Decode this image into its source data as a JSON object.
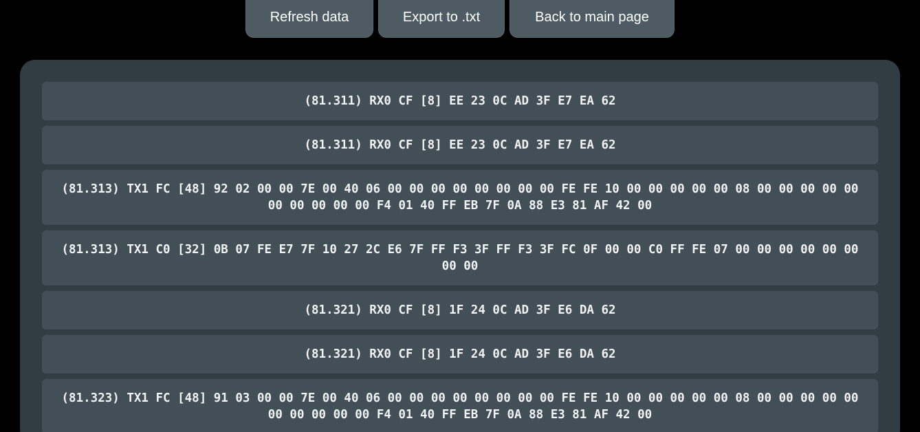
{
  "toolbar": {
    "refresh_label": "Refresh data",
    "export_label": "Export to .txt",
    "back_label": "Back to main page"
  },
  "log": {
    "rows": [
      "(81.311) RX0 CF [8] EE 23 0C AD 3F E7 EA 62",
      "(81.311) RX0 CF [8] EE 23 0C AD 3F E7 EA 62",
      "(81.313) TX1 FC [48] 92 02 00 00 7E 00 40 06 00 00 00 00 00 00 00 00 FE FE 10 00 00 00 00 00 08 00 00 00 00 00 00 00 00 00 00 F4 01 40 FF EB 7F 0A 88 E3 81 AF 42 00",
      "(81.313) TX1 C0 [32] 0B 07 FE E7 7F 10 27 2C E6 7F FF F3 3F FF F3 3F FC 0F 00 00 C0 FF FE 07 00 00 00 00 00 00 00 00",
      "(81.321) RX0 CF [8] 1F 24 0C AD 3F E6 DA 62",
      "(81.321) RX0 CF [8] 1F 24 0C AD 3F E6 DA 62",
      "(81.323) TX1 FC [48] 91 03 00 00 7E 00 40 06 00 00 00 00 00 00 00 00 FE FE 10 00 00 00 00 00 08 00 00 00 00 00 00 00 00 00 00 F4 01 40 FF EB 7F 0A 88 E3 81 AF 42 00"
    ]
  },
  "colors": {
    "background": "#000000",
    "panel": "#313c43",
    "row": "#434f57",
    "button": "#4e5b63",
    "text": "#ffffff"
  }
}
